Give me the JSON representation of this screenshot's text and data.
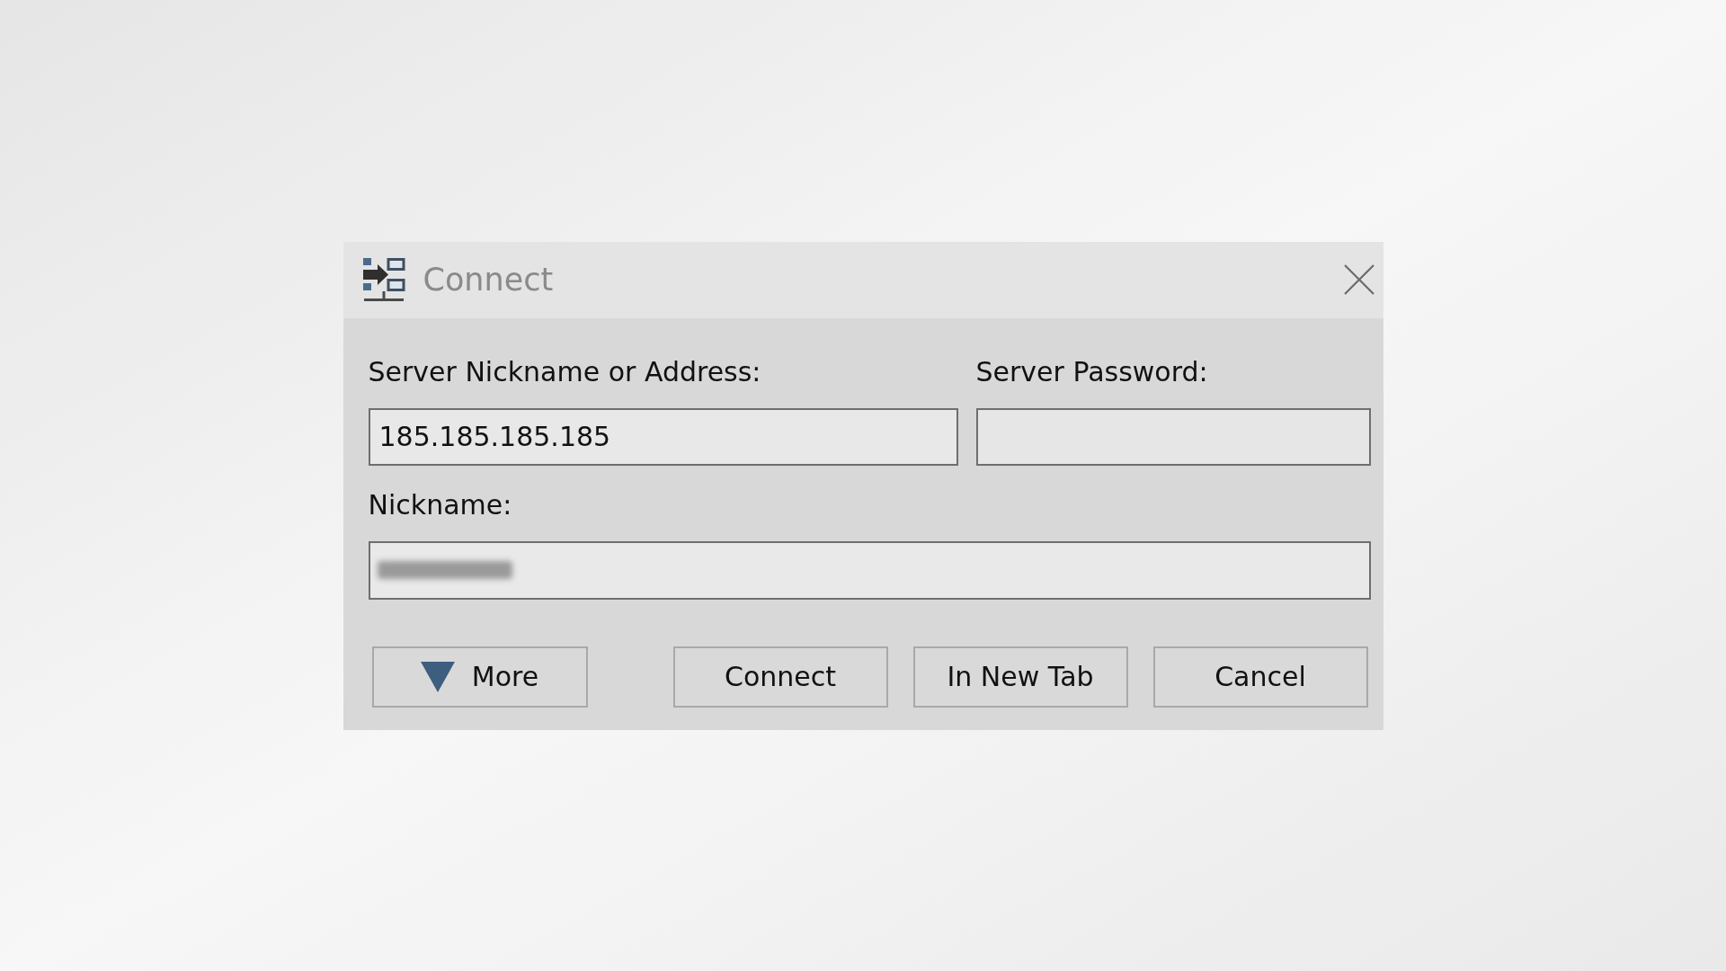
{
  "window": {
    "title": "Connect"
  },
  "server": {
    "label": "Server Nickname or Address:",
    "value": "185.185.185.185"
  },
  "password": {
    "label": "Server Password:"
  },
  "nickname": {
    "label": "Nickname:",
    "value_blurred": true
  },
  "more_button": {
    "label": "More"
  },
  "buttons": [
    "Connect",
    "In New Tab",
    "Cancel"
  ]
}
